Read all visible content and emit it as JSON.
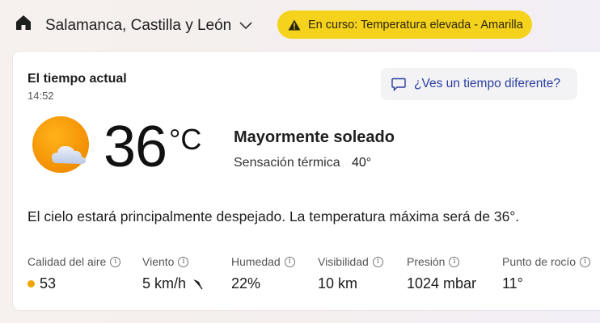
{
  "header": {
    "location": "Salamanca, Castilla y León",
    "alert": "En curso: Temperatura elevada - Amarilla",
    "icons": {
      "home": "home-icon",
      "dropdown": "chevron-down-icon",
      "alert": "warning-triangle-icon"
    }
  },
  "current": {
    "title": "El tiempo actual",
    "time": "14:52",
    "feedback": "¿Ves un tiempo diferente?",
    "temperature": "36",
    "unit": "°C",
    "condition": "Mayormente soleado",
    "feels_like_label": "Sensación térmica",
    "feels_like_value": "40°",
    "summary": "El cielo estará principalmente despejado. La temperatura máxima será de 36°.",
    "weather_icon": "sun-behind-cloud-icon"
  },
  "metrics": [
    {
      "label": "Calidad del aire",
      "value": "53"
    },
    {
      "label": "Viento",
      "value": "5 km/h"
    },
    {
      "label": "Humedad",
      "value": "22%"
    },
    {
      "label": "Visibilidad",
      "value": "10 km"
    },
    {
      "label": "Presión",
      "value": "1024 mbar"
    },
    {
      "label": "Punto de rocío",
      "value": "11°"
    }
  ],
  "colors": {
    "alert_yellow": "#f5d21c",
    "air_quality_dot": "#f2a500",
    "link_blue": "#2b3d9e"
  }
}
